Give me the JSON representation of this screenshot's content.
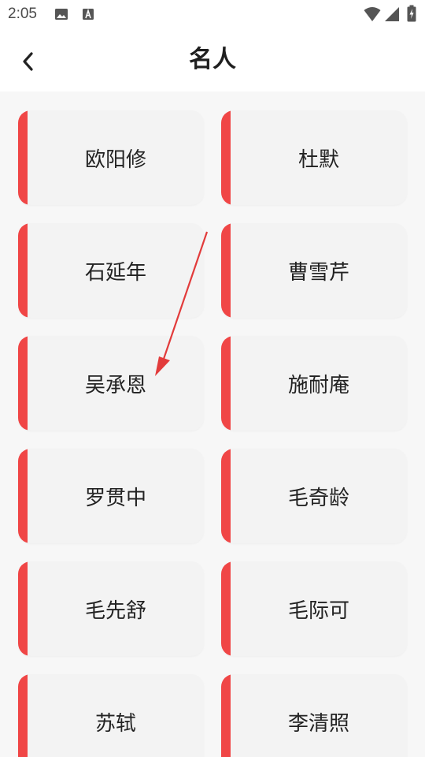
{
  "status_bar": {
    "time": "2:05",
    "icons": [
      "image-icon",
      "a-box-icon",
      "wifi-icon",
      "signal-icon",
      "battery-charging-icon"
    ]
  },
  "app_bar": {
    "title": "名人",
    "back_icon": "chevron-left-icon"
  },
  "accent_color": "#f04646",
  "people": [
    {
      "name": "欧阳修"
    },
    {
      "name": "杜默"
    },
    {
      "name": "石延年"
    },
    {
      "name": "曹雪芹"
    },
    {
      "name": "吴承恩"
    },
    {
      "name": "施耐庵"
    },
    {
      "name": "罗贯中"
    },
    {
      "name": "毛奇龄"
    },
    {
      "name": "毛先舒"
    },
    {
      "name": "毛际可"
    },
    {
      "name": "苏轼"
    },
    {
      "name": "李清照"
    }
  ]
}
